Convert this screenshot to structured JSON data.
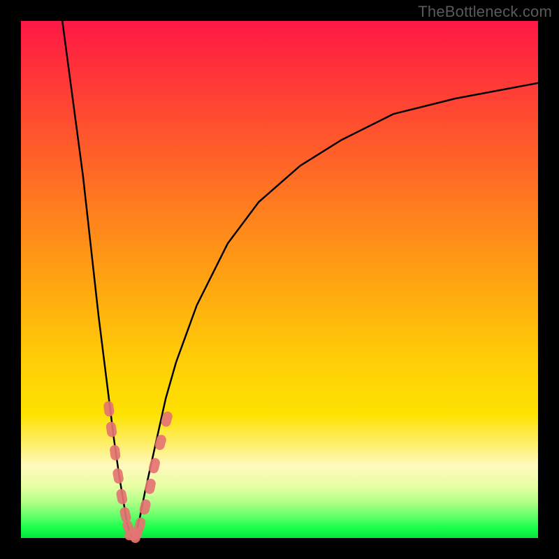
{
  "watermark": "TheBottleneck.com",
  "colors": {
    "frame": "#000000",
    "curve": "#000000",
    "marker_fill": "#e57373",
    "marker_stroke": "#c55a5a"
  },
  "chart_data": {
    "type": "line",
    "title": "",
    "xlabel": "",
    "ylabel": "",
    "xlim": [
      0,
      100
    ],
    "ylim": [
      0,
      100
    ],
    "grid": false,
    "note": "Axes have no visible tick labels; values are estimated proportions of plot width/height (0–100). y = 0 is the green bottom, y = 100 is the top.",
    "series": [
      {
        "name": "left-branch",
        "x": [
          8,
          10,
          12,
          14,
          15,
          16,
          17,
          18,
          19,
          20,
          20.5,
          21,
          21.5
        ],
        "y": [
          100,
          85,
          70,
          52,
          43,
          35,
          27,
          19,
          12,
          6,
          3,
          1,
          0
        ]
      },
      {
        "name": "right-branch",
        "x": [
          22,
          23,
          24,
          26,
          28,
          30,
          34,
          40,
          46,
          54,
          62,
          72,
          84,
          100
        ],
        "y": [
          0,
          4,
          9,
          18,
          27,
          34,
          45,
          57,
          65,
          72,
          77,
          82,
          85,
          88
        ]
      }
    ],
    "markers": {
      "name": "data-points",
      "shape": "rounded",
      "points": [
        {
          "x": 17.0,
          "y": 25.0
        },
        {
          "x": 17.5,
          "y": 21.0
        },
        {
          "x": 18.2,
          "y": 16.5
        },
        {
          "x": 18.8,
          "y": 12.0
        },
        {
          "x": 19.5,
          "y": 8.0
        },
        {
          "x": 20.2,
          "y": 4.5
        },
        {
          "x": 20.8,
          "y": 2.0
        },
        {
          "x": 21.5,
          "y": 0.5
        },
        {
          "x": 22.3,
          "y": 0.5
        },
        {
          "x": 23.0,
          "y": 2.5
        },
        {
          "x": 24.0,
          "y": 6.0
        },
        {
          "x": 25.0,
          "y": 10.0
        },
        {
          "x": 25.8,
          "y": 14.0
        },
        {
          "x": 27.0,
          "y": 18.5
        },
        {
          "x": 28.2,
          "y": 23.0
        }
      ]
    }
  }
}
